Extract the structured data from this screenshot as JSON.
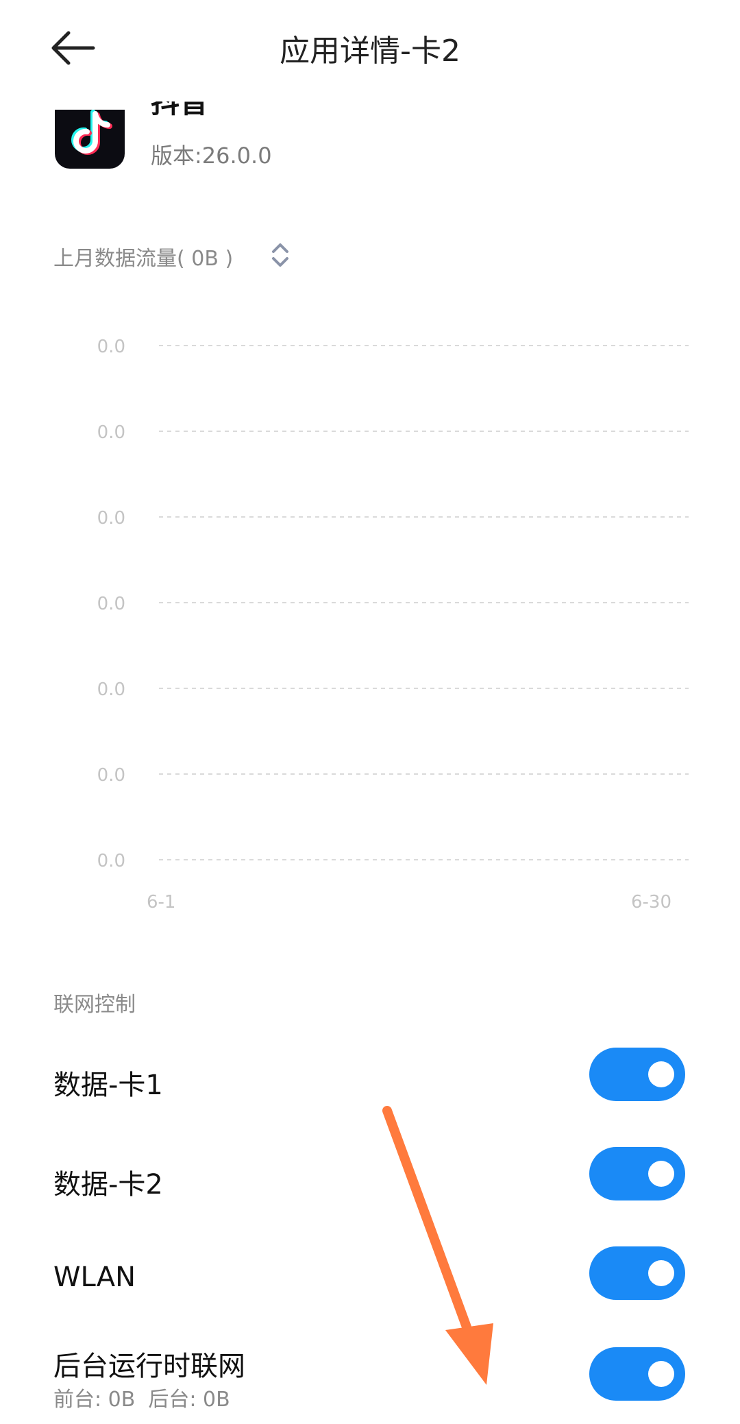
{
  "header": {
    "title": "应用详情-卡2",
    "back_icon": "arrow-left-icon"
  },
  "app": {
    "name": "抖音",
    "version": "版本:26.0.0",
    "icon": "tiktok-app-icon"
  },
  "usage": {
    "label": "上月数据流量( 0B )",
    "toggle_icon": "chevron-up-down-icon"
  },
  "chart_data": {
    "type": "line",
    "x_tick_labels": [
      "6-1",
      "6-30"
    ],
    "y_tick_labels": [
      "0.0",
      "0.0",
      "0.0",
      "0.0",
      "0.0",
      "0.0",
      "0.0"
    ],
    "series": [],
    "grid": true
  },
  "network": {
    "section_title": "联网控制",
    "items": [
      {
        "label": "数据-卡1",
        "enabled": true
      },
      {
        "label": "数据-卡2",
        "enabled": true
      },
      {
        "label": "WLAN",
        "enabled": true
      },
      {
        "label": "后台运行时联网",
        "sub": "前台: 0B  后台: 0B",
        "enabled": true
      }
    ]
  },
  "colors": {
    "accent": "#1a8af6",
    "annotation_arrow": "#ff7a3d"
  }
}
